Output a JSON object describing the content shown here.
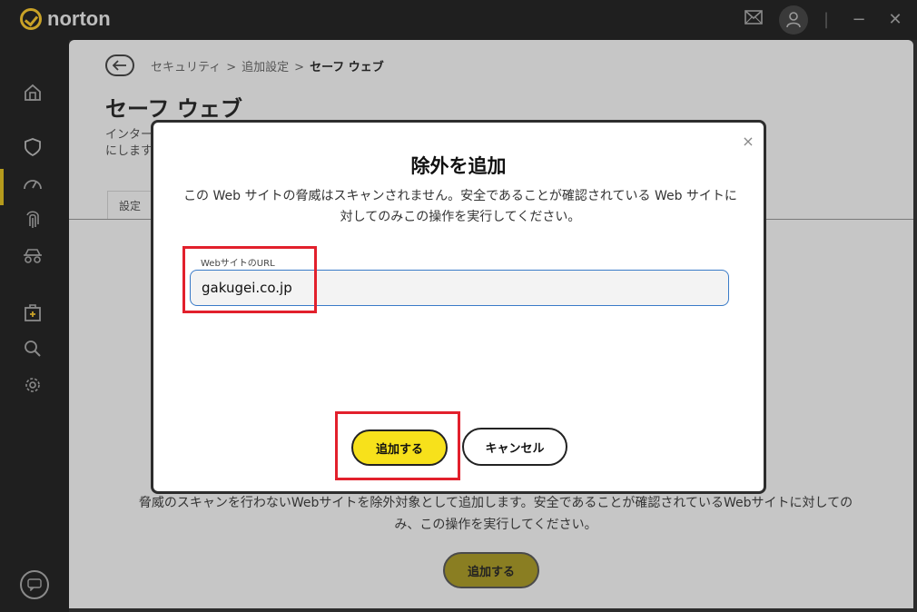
{
  "app": {
    "brand": "norton"
  },
  "titlebar": {
    "mail_icon": "mail-icon",
    "account_icon": "user-icon",
    "minimize_glyph": "−",
    "close_glyph": "✕"
  },
  "sidebar": {
    "items": [
      {
        "name": "home-icon"
      },
      {
        "name": "shield-icon",
        "active": true
      },
      {
        "name": "speedometer-icon"
      },
      {
        "name": "fingerprint-icon"
      },
      {
        "name": "incognito-icon"
      },
      {
        "name": "medkit-icon"
      },
      {
        "name": "search-icon"
      },
      {
        "name": "gear-icon"
      }
    ],
    "chat_icon": "chat-icon"
  },
  "breadcrumb": {
    "items": [
      "セキュリティ",
      "追加設定",
      "セーフ ウェブ"
    ],
    "separator": ">"
  },
  "page": {
    "title": "セーフ ウェブ",
    "desc_line1": "インター",
    "desc_line2": "にします",
    "tab_settings": "設定",
    "body_text": "脅威のスキャンを行わないWebサイトを除外対象として追加します。安全であることが確認されているWebサイトに対してのみ、この操作を実行してください。",
    "add_button": "追加する"
  },
  "dialog": {
    "title": "除外を追加",
    "description": "この Web サイトの脅威はスキャンされません。安全であることが確認されている Web サイトに対してのみこの操作を実行してください。",
    "url_label": "WebサイトのURL",
    "url_value": "gakugei.co.jp",
    "add_button": "追加する",
    "cancel_button": "キャンセル",
    "close_glyph": "×"
  },
  "colors": {
    "accent_yellow": "#f7e11b",
    "highlight_red": "#e2202c",
    "input_border": "#3a7bc8"
  }
}
